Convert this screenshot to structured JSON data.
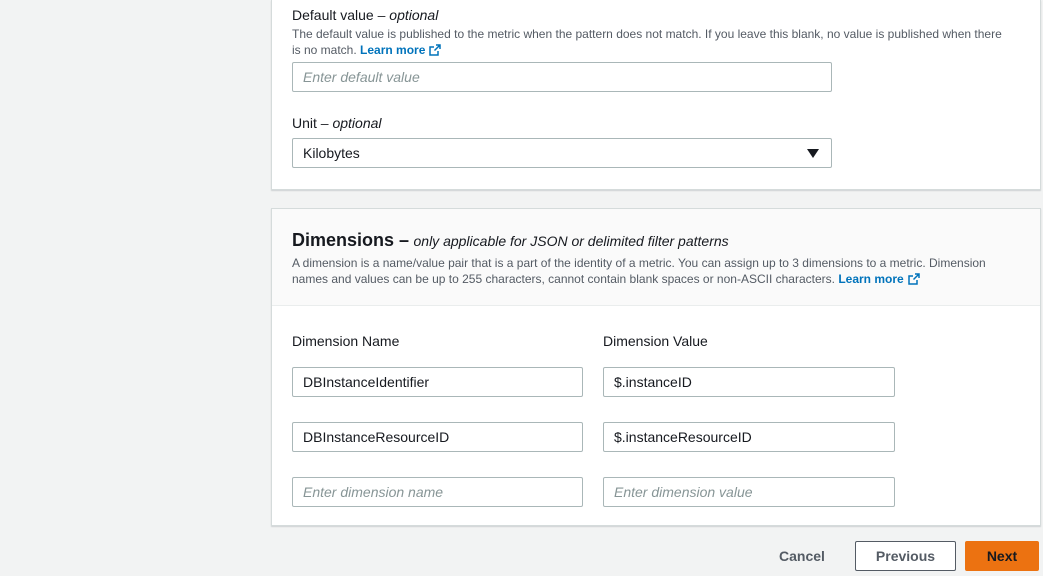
{
  "metric": {
    "default_value": {
      "label": "Default value",
      "optional": "– optional",
      "description": "The default value is published to the metric when the pattern does not match. If you leave this blank, no value is published when there is no match.",
      "learn_more": "Learn more",
      "placeholder": "Enter default value"
    },
    "unit": {
      "label": "Unit",
      "optional": "– optional",
      "selected": "Kilobytes"
    }
  },
  "dimensions": {
    "title": "Dimensions –",
    "subtitle": "only applicable for JSON or delimited filter patterns",
    "description": "A dimension is a name/value pair that is a part of the identity of a metric. You can assign up to 3 dimensions to a metric. Dimension names and values can be up to 255 characters, cannot contain blank spaces or non-ASCII characters.",
    "learn_more": "Learn more",
    "name_header": "Dimension Name",
    "value_header": "Dimension Value",
    "rows": [
      {
        "name": "DBInstanceIdentifier",
        "value": "$.instanceID"
      },
      {
        "name": "DBInstanceResourceID",
        "value": "$.instanceResourceID"
      }
    ],
    "name_placeholder": "Enter dimension name",
    "value_placeholder": "Enter dimension value"
  },
  "footer": {
    "cancel": "Cancel",
    "previous": "Previous",
    "next": "Next"
  },
  "colors": {
    "link": "#0073bb",
    "primary_button": "#ec7211",
    "page_background": "#f2f3f3"
  }
}
